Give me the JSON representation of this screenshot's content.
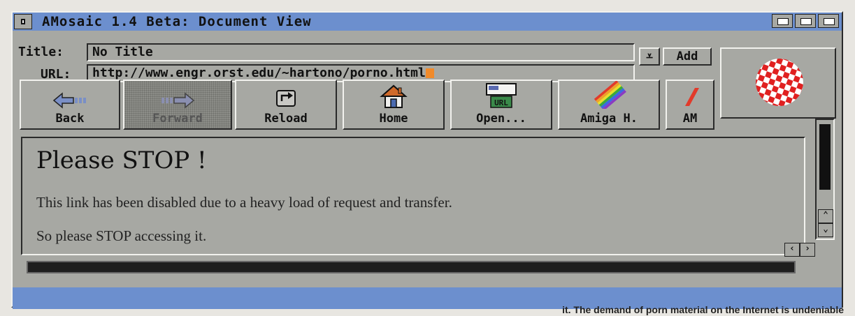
{
  "window": {
    "title": "AMosaic 1.4 Beta: Document View"
  },
  "location": {
    "title_label": "Title:",
    "title_value": "No Title",
    "url_label": "URL:",
    "url_value": "http://www.engr.orst.edu/~hartono/porno.html",
    "add_label": "Add"
  },
  "toolbar": {
    "buttons": [
      {
        "label": "Back",
        "icon": "back-arrow-icon"
      },
      {
        "label": "Forward",
        "icon": "forward-arrow-icon"
      },
      {
        "label": "Reload",
        "icon": "reload-icon"
      },
      {
        "label": "Home",
        "icon": "home-icon"
      },
      {
        "label": "Open...",
        "icon": "url-open-icon"
      },
      {
        "label": "Amiga H.",
        "icon": "amiga-rainbow-icon"
      },
      {
        "label": "AM",
        "icon": "am-icon"
      }
    ]
  },
  "document": {
    "heading": "Please STOP !",
    "paragraph1": "This link has been disabled due to a heavy load of request and transfer.",
    "paragraph2": "So please STOP accessing it."
  },
  "caption": "it. The demand of porn material on the Internet is undeniable",
  "colors": {
    "titlebar": "#6c8fce",
    "chrome": "#a7a8a3",
    "cursor": "#f08a2a",
    "boing_red": "#e02020"
  }
}
